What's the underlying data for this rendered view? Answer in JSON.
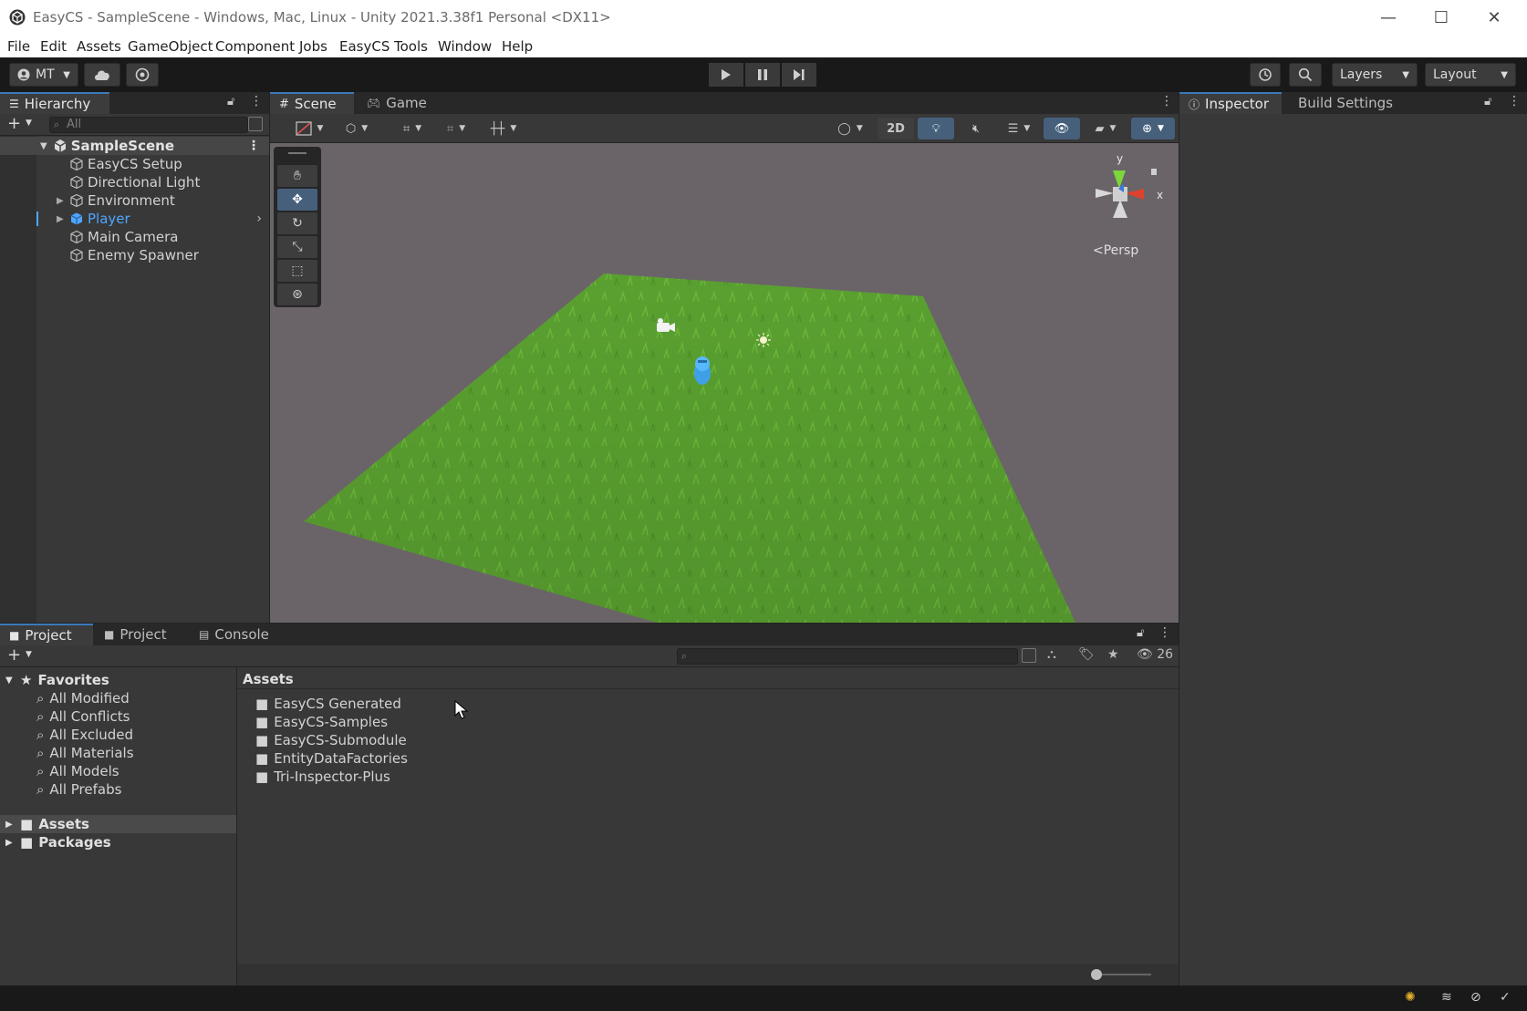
{
  "window": {
    "title": "EasyCS - SampleScene - Windows, Mac, Linux - Unity 2021.3.38f1 Personal <DX11>"
  },
  "menu": [
    "File",
    "Edit",
    "Assets",
    "GameObject",
    "Component",
    "Jobs",
    "EasyCS",
    "Tools",
    "Window",
    "Help"
  ],
  "toolbar": {
    "account": "MT",
    "layers": "Layers",
    "layout": "Layout"
  },
  "hierarchy": {
    "tab": "Hierarchy",
    "search_placeholder": "All",
    "scene": "SampleScene",
    "items": [
      {
        "label": "EasyCS Setup"
      },
      {
        "label": "Directional Light"
      },
      {
        "label": "Environment"
      },
      {
        "label": "Player"
      },
      {
        "label": "Main Camera"
      },
      {
        "label": "Enemy Spawner"
      }
    ]
  },
  "scene_view": {
    "tabs": [
      "Scene",
      "Game"
    ],
    "mode_2d": "2D",
    "gizmo": {
      "y": "y",
      "x": "x",
      "projection": "Persp"
    }
  },
  "inspector": {
    "tabs": [
      "Inspector",
      "Build Settings"
    ]
  },
  "project": {
    "tabs": [
      "Project",
      "Project",
      "Console"
    ],
    "hidden_count": "26",
    "favorites_label": "Favorites",
    "favorites": [
      "All Modified",
      "All Conflicts",
      "All Excluded",
      "All Materials",
      "All Models",
      "All Prefabs"
    ],
    "roots": [
      "Assets",
      "Packages"
    ],
    "assets_header": "Assets",
    "folders": [
      "EasyCS Generated",
      "EasyCS-Samples",
      "EasyCS-Submodule",
      "EntityDataFactories",
      "Tri-Inspector-Plus"
    ]
  },
  "colors": {
    "accent": "#46607c",
    "selection": "#4a4a4a",
    "player_text": "#4fa6ff",
    "grass": "#5aa030"
  }
}
